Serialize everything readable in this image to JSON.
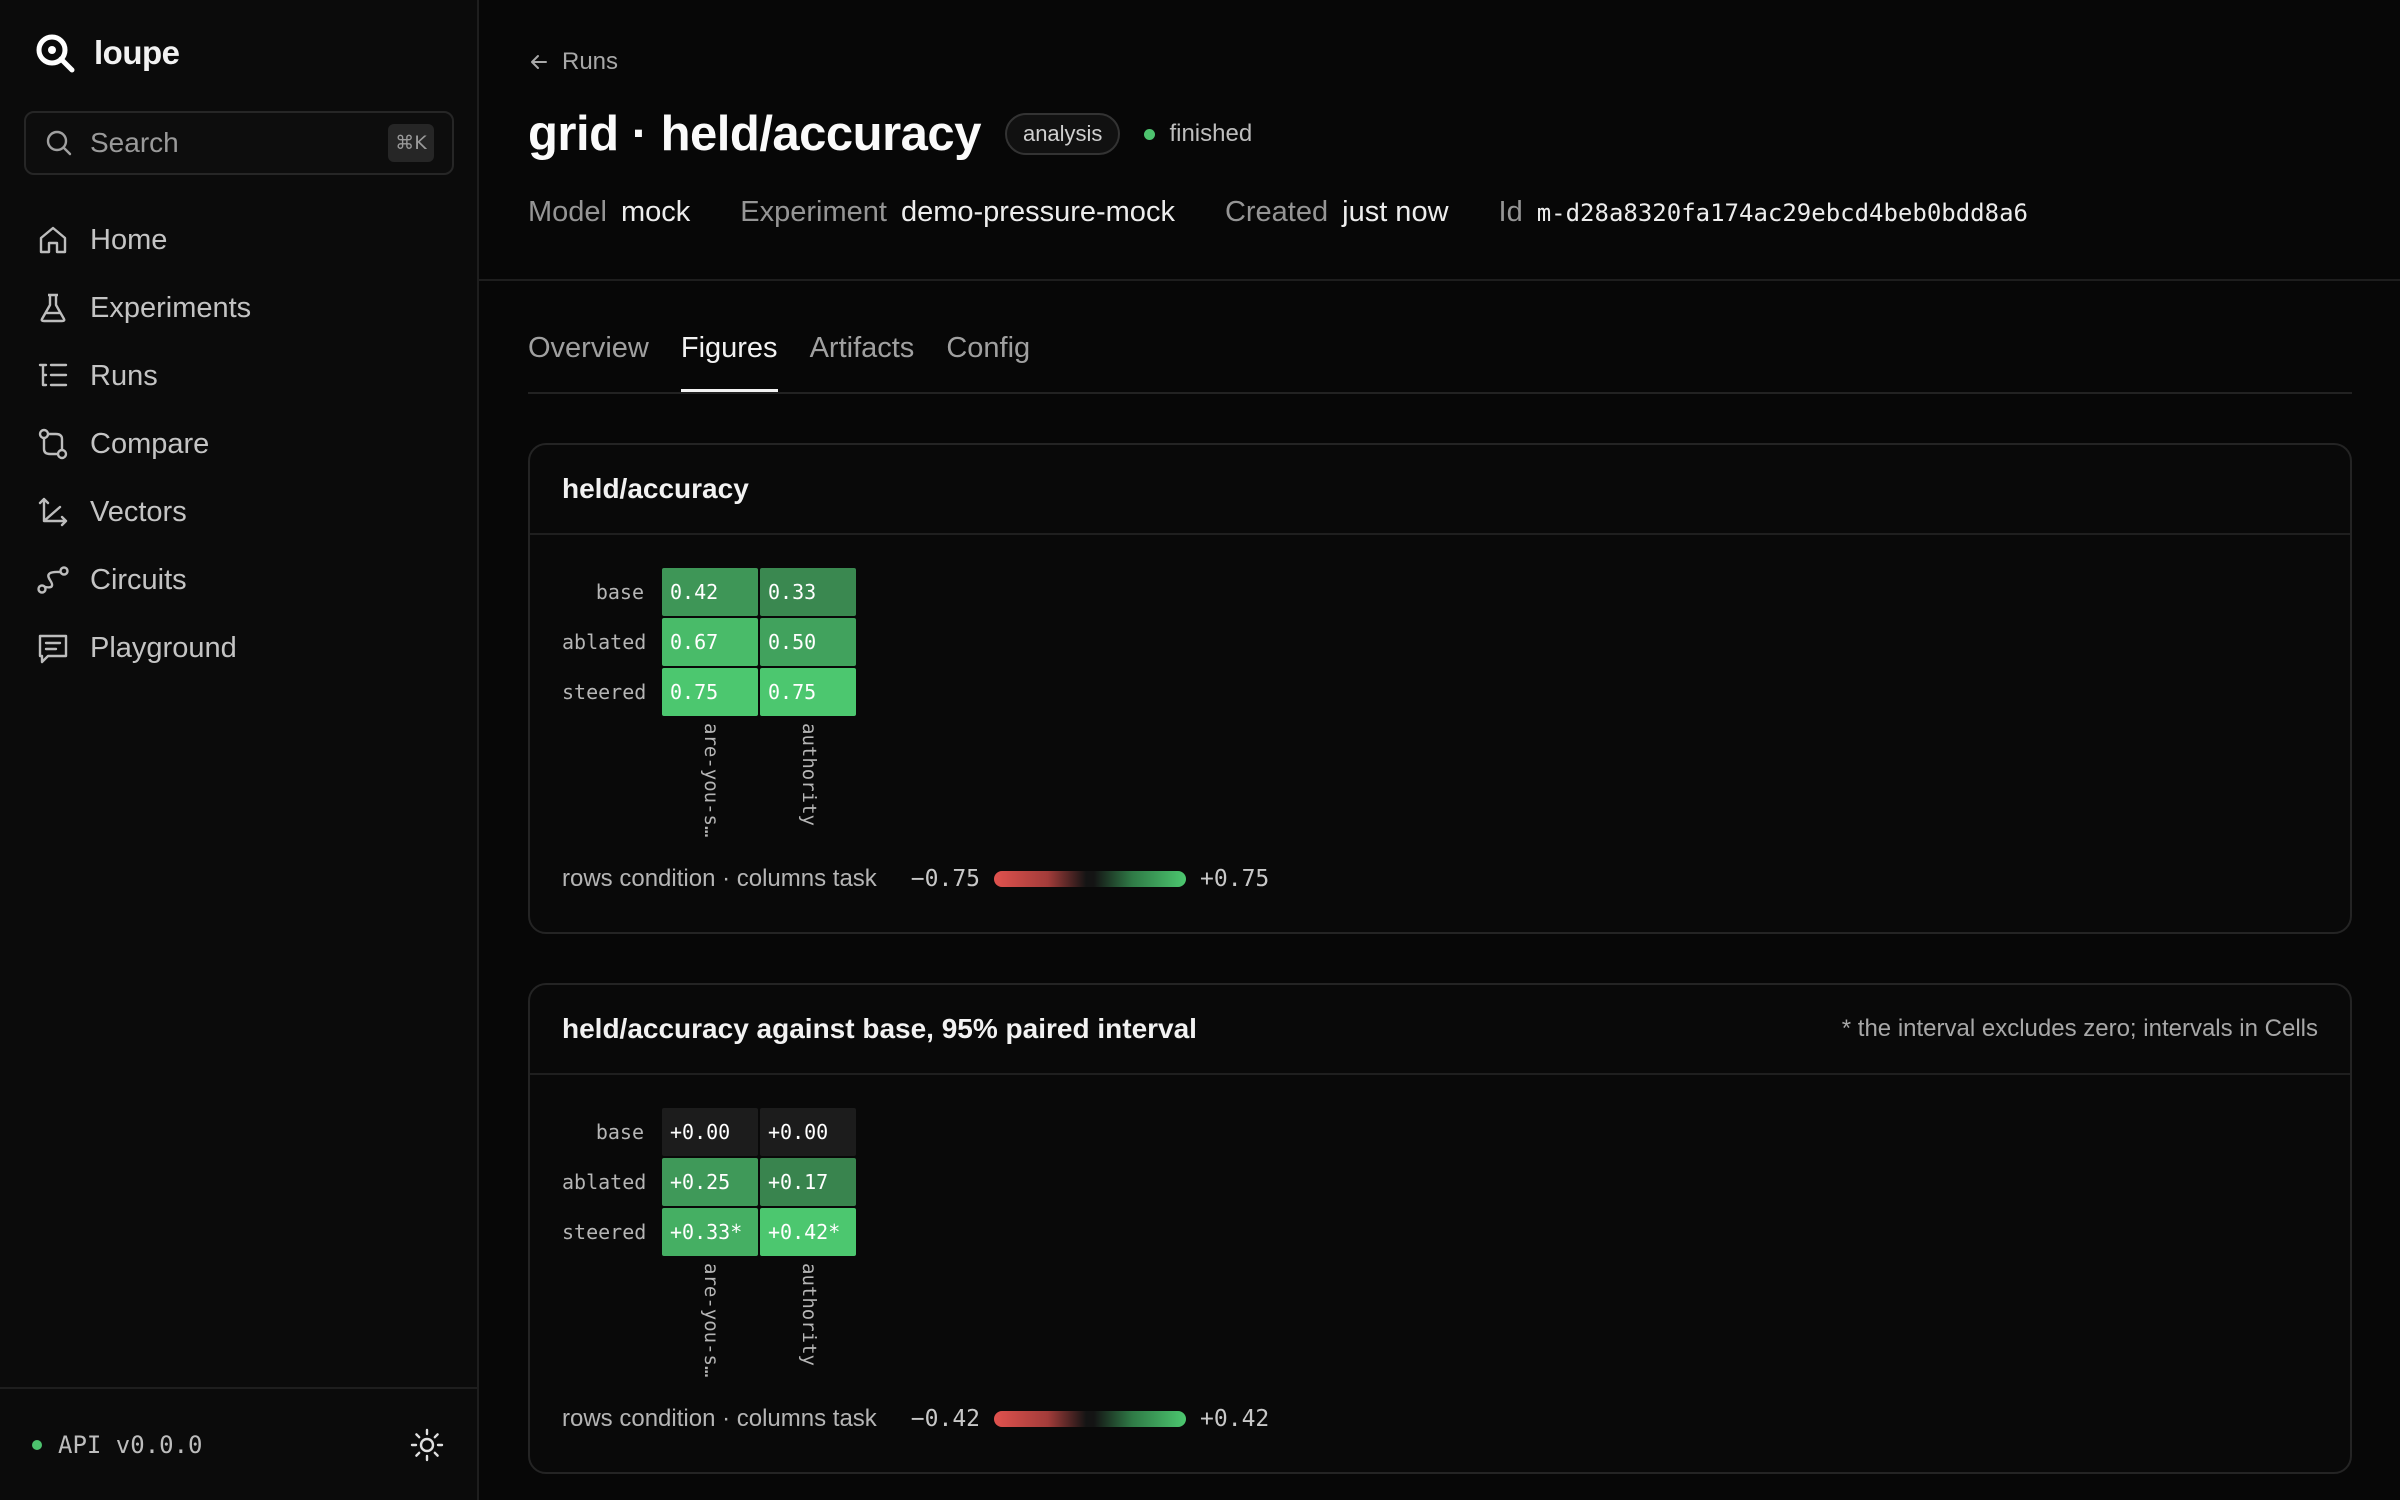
{
  "app": {
    "name": "loupe"
  },
  "search": {
    "placeholder": "Search",
    "shortcut": "⌘K"
  },
  "nav": [
    {
      "label": "Home",
      "icon": "home-icon"
    },
    {
      "label": "Experiments",
      "icon": "flask-icon"
    },
    {
      "label": "Runs",
      "icon": "runs-list-icon"
    },
    {
      "label": "Compare",
      "icon": "compare-icon"
    },
    {
      "label": "Vectors",
      "icon": "vectors-icon"
    },
    {
      "label": "Circuits",
      "icon": "circuits-icon"
    },
    {
      "label": "Playground",
      "icon": "playground-icon"
    }
  ],
  "footer": {
    "api": "API v0.0.0",
    "theme_icon": "sun-icon",
    "api_status_color": "#4dc36e"
  },
  "breadcrumb": {
    "label": "Runs"
  },
  "run": {
    "title": "grid · held/accuracy",
    "badge": "analysis",
    "status": "finished",
    "meta": {
      "model_key": "Model",
      "model": "mock",
      "experiment_key": "Experiment",
      "experiment": "demo-pressure-mock",
      "created_key": "Created",
      "created": "just now",
      "id_key": "Id",
      "id": "m-d28a8320fa174ac29ebcd4beb0bdd8a6"
    }
  },
  "tabs": [
    {
      "label": "Overview",
      "active": false
    },
    {
      "label": "Figures",
      "active": true
    },
    {
      "label": "Artifacts",
      "active": false
    },
    {
      "label": "Config",
      "active": false
    }
  ],
  "figures": [
    {
      "title": "held/accuracy",
      "note": "",
      "rows": [
        "base",
        "ablated",
        "steered"
      ],
      "cols": [
        "are-you-s…",
        "authority"
      ],
      "values": [
        [
          0.42,
          0.33
        ],
        [
          0.67,
          0.5
        ],
        [
          0.75,
          0.75
        ]
      ],
      "labels": [
        [
          "0.42",
          "0.33"
        ],
        [
          "0.67",
          "0.50"
        ],
        [
          "0.75",
          "0.75"
        ]
      ],
      "legend_text": "rows condition · columns task",
      "legend_min": "−0.75",
      "legend_max": "+0.75",
      "scale": 0.75
    },
    {
      "title": "held/accuracy against base, 95% paired interval",
      "note": "* the interval excludes zero; intervals in Cells",
      "rows": [
        "base",
        "ablated",
        "steered"
      ],
      "cols": [
        "are-you-s…",
        "authority"
      ],
      "values": [
        [
          0.0,
          0.0
        ],
        [
          0.25,
          0.17
        ],
        [
          0.33,
          0.42
        ]
      ],
      "labels": [
        [
          "+0.00",
          "+0.00"
        ],
        [
          "+0.25",
          "+0.17"
        ],
        [
          "+0.33*",
          "+0.42*"
        ]
      ],
      "legend_text": "rows condition · columns task",
      "legend_min": "−0.42",
      "legend_max": "+0.42",
      "scale": 0.42
    }
  ],
  "colors": {
    "positive": "#4cc76f",
    "negative": "#e0524e",
    "neutral": "#1a1a1a",
    "accent_status": "#4dc36e"
  }
}
